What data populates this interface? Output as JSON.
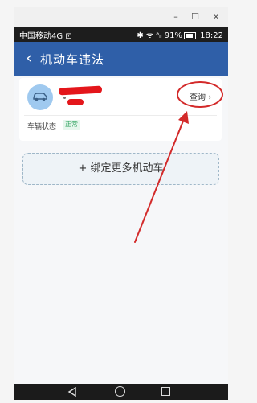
{
  "window_controls": {
    "minimize": "–",
    "maximize": "☐",
    "close": "×"
  },
  "status_bar": {
    "carrier": "中国移动4G",
    "icons_left": "⊡",
    "icons_right": "✱ ᯤ ᵃᵢₗ",
    "battery": "91%",
    "time": "18:22"
  },
  "app_bar": {
    "back": "‹",
    "title": "机动车违法"
  },
  "vehicle_card": {
    "avatar_icon": "car-icon",
    "query_label": "查询",
    "query_chevron": "›",
    "status_label": "车辆状态",
    "status_value": "正常",
    "status_color": "#2aa05b"
  },
  "bind_more": {
    "label": "+ 绑定更多机动车"
  },
  "colors": {
    "primary": "#2f5fa8",
    "annotation": "#d32a2a"
  }
}
